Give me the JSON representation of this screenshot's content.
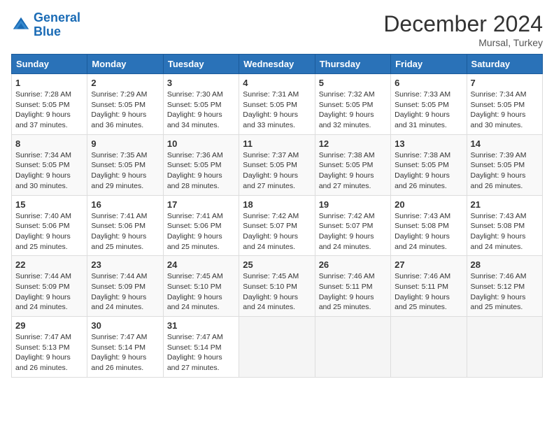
{
  "logo": {
    "line1": "General",
    "line2": "Blue"
  },
  "title": "December 2024",
  "subtitle": "Mursal, Turkey",
  "headers": [
    "Sunday",
    "Monday",
    "Tuesday",
    "Wednesday",
    "Thursday",
    "Friday",
    "Saturday"
  ],
  "weeks": [
    [
      {
        "day": "1",
        "sunrise": "7:28 AM",
        "sunset": "5:05 PM",
        "daylight": "9 hours and 37 minutes."
      },
      {
        "day": "2",
        "sunrise": "7:29 AM",
        "sunset": "5:05 PM",
        "daylight": "9 hours and 36 minutes."
      },
      {
        "day": "3",
        "sunrise": "7:30 AM",
        "sunset": "5:05 PM",
        "daylight": "9 hours and 34 minutes."
      },
      {
        "day": "4",
        "sunrise": "7:31 AM",
        "sunset": "5:05 PM",
        "daylight": "9 hours and 33 minutes."
      },
      {
        "day": "5",
        "sunrise": "7:32 AM",
        "sunset": "5:05 PM",
        "daylight": "9 hours and 32 minutes."
      },
      {
        "day": "6",
        "sunrise": "7:33 AM",
        "sunset": "5:05 PM",
        "daylight": "9 hours and 31 minutes."
      },
      {
        "day": "7",
        "sunrise": "7:34 AM",
        "sunset": "5:05 PM",
        "daylight": "9 hours and 30 minutes."
      }
    ],
    [
      {
        "day": "8",
        "sunrise": "7:34 AM",
        "sunset": "5:05 PM",
        "daylight": "9 hours and 30 minutes."
      },
      {
        "day": "9",
        "sunrise": "7:35 AM",
        "sunset": "5:05 PM",
        "daylight": "9 hours and 29 minutes."
      },
      {
        "day": "10",
        "sunrise": "7:36 AM",
        "sunset": "5:05 PM",
        "daylight": "9 hours and 28 minutes."
      },
      {
        "day": "11",
        "sunrise": "7:37 AM",
        "sunset": "5:05 PM",
        "daylight": "9 hours and 27 minutes."
      },
      {
        "day": "12",
        "sunrise": "7:38 AM",
        "sunset": "5:05 PM",
        "daylight": "9 hours and 27 minutes."
      },
      {
        "day": "13",
        "sunrise": "7:38 AM",
        "sunset": "5:05 PM",
        "daylight": "9 hours and 26 minutes."
      },
      {
        "day": "14",
        "sunrise": "7:39 AM",
        "sunset": "5:05 PM",
        "daylight": "9 hours and 26 minutes."
      }
    ],
    [
      {
        "day": "15",
        "sunrise": "7:40 AM",
        "sunset": "5:06 PM",
        "daylight": "9 hours and 25 minutes."
      },
      {
        "day": "16",
        "sunrise": "7:41 AM",
        "sunset": "5:06 PM",
        "daylight": "9 hours and 25 minutes."
      },
      {
        "day": "17",
        "sunrise": "7:41 AM",
        "sunset": "5:06 PM",
        "daylight": "9 hours and 25 minutes."
      },
      {
        "day": "18",
        "sunrise": "7:42 AM",
        "sunset": "5:07 PM",
        "daylight": "9 hours and 24 minutes."
      },
      {
        "day": "19",
        "sunrise": "7:42 AM",
        "sunset": "5:07 PM",
        "daylight": "9 hours and 24 minutes."
      },
      {
        "day": "20",
        "sunrise": "7:43 AM",
        "sunset": "5:08 PM",
        "daylight": "9 hours and 24 minutes."
      },
      {
        "day": "21",
        "sunrise": "7:43 AM",
        "sunset": "5:08 PM",
        "daylight": "9 hours and 24 minutes."
      }
    ],
    [
      {
        "day": "22",
        "sunrise": "7:44 AM",
        "sunset": "5:09 PM",
        "daylight": "9 hours and 24 minutes."
      },
      {
        "day": "23",
        "sunrise": "7:44 AM",
        "sunset": "5:09 PM",
        "daylight": "9 hours and 24 minutes."
      },
      {
        "day": "24",
        "sunrise": "7:45 AM",
        "sunset": "5:10 PM",
        "daylight": "9 hours and 24 minutes."
      },
      {
        "day": "25",
        "sunrise": "7:45 AM",
        "sunset": "5:10 PM",
        "daylight": "9 hours and 24 minutes."
      },
      {
        "day": "26",
        "sunrise": "7:46 AM",
        "sunset": "5:11 PM",
        "daylight": "9 hours and 25 minutes."
      },
      {
        "day": "27",
        "sunrise": "7:46 AM",
        "sunset": "5:11 PM",
        "daylight": "9 hours and 25 minutes."
      },
      {
        "day": "28",
        "sunrise": "7:46 AM",
        "sunset": "5:12 PM",
        "daylight": "9 hours and 25 minutes."
      }
    ],
    [
      {
        "day": "29",
        "sunrise": "7:47 AM",
        "sunset": "5:13 PM",
        "daylight": "9 hours and 26 minutes."
      },
      {
        "day": "30",
        "sunrise": "7:47 AM",
        "sunset": "5:14 PM",
        "daylight": "9 hours and 26 minutes."
      },
      {
        "day": "31",
        "sunrise": "7:47 AM",
        "sunset": "5:14 PM",
        "daylight": "9 hours and 27 minutes."
      },
      null,
      null,
      null,
      null
    ]
  ]
}
